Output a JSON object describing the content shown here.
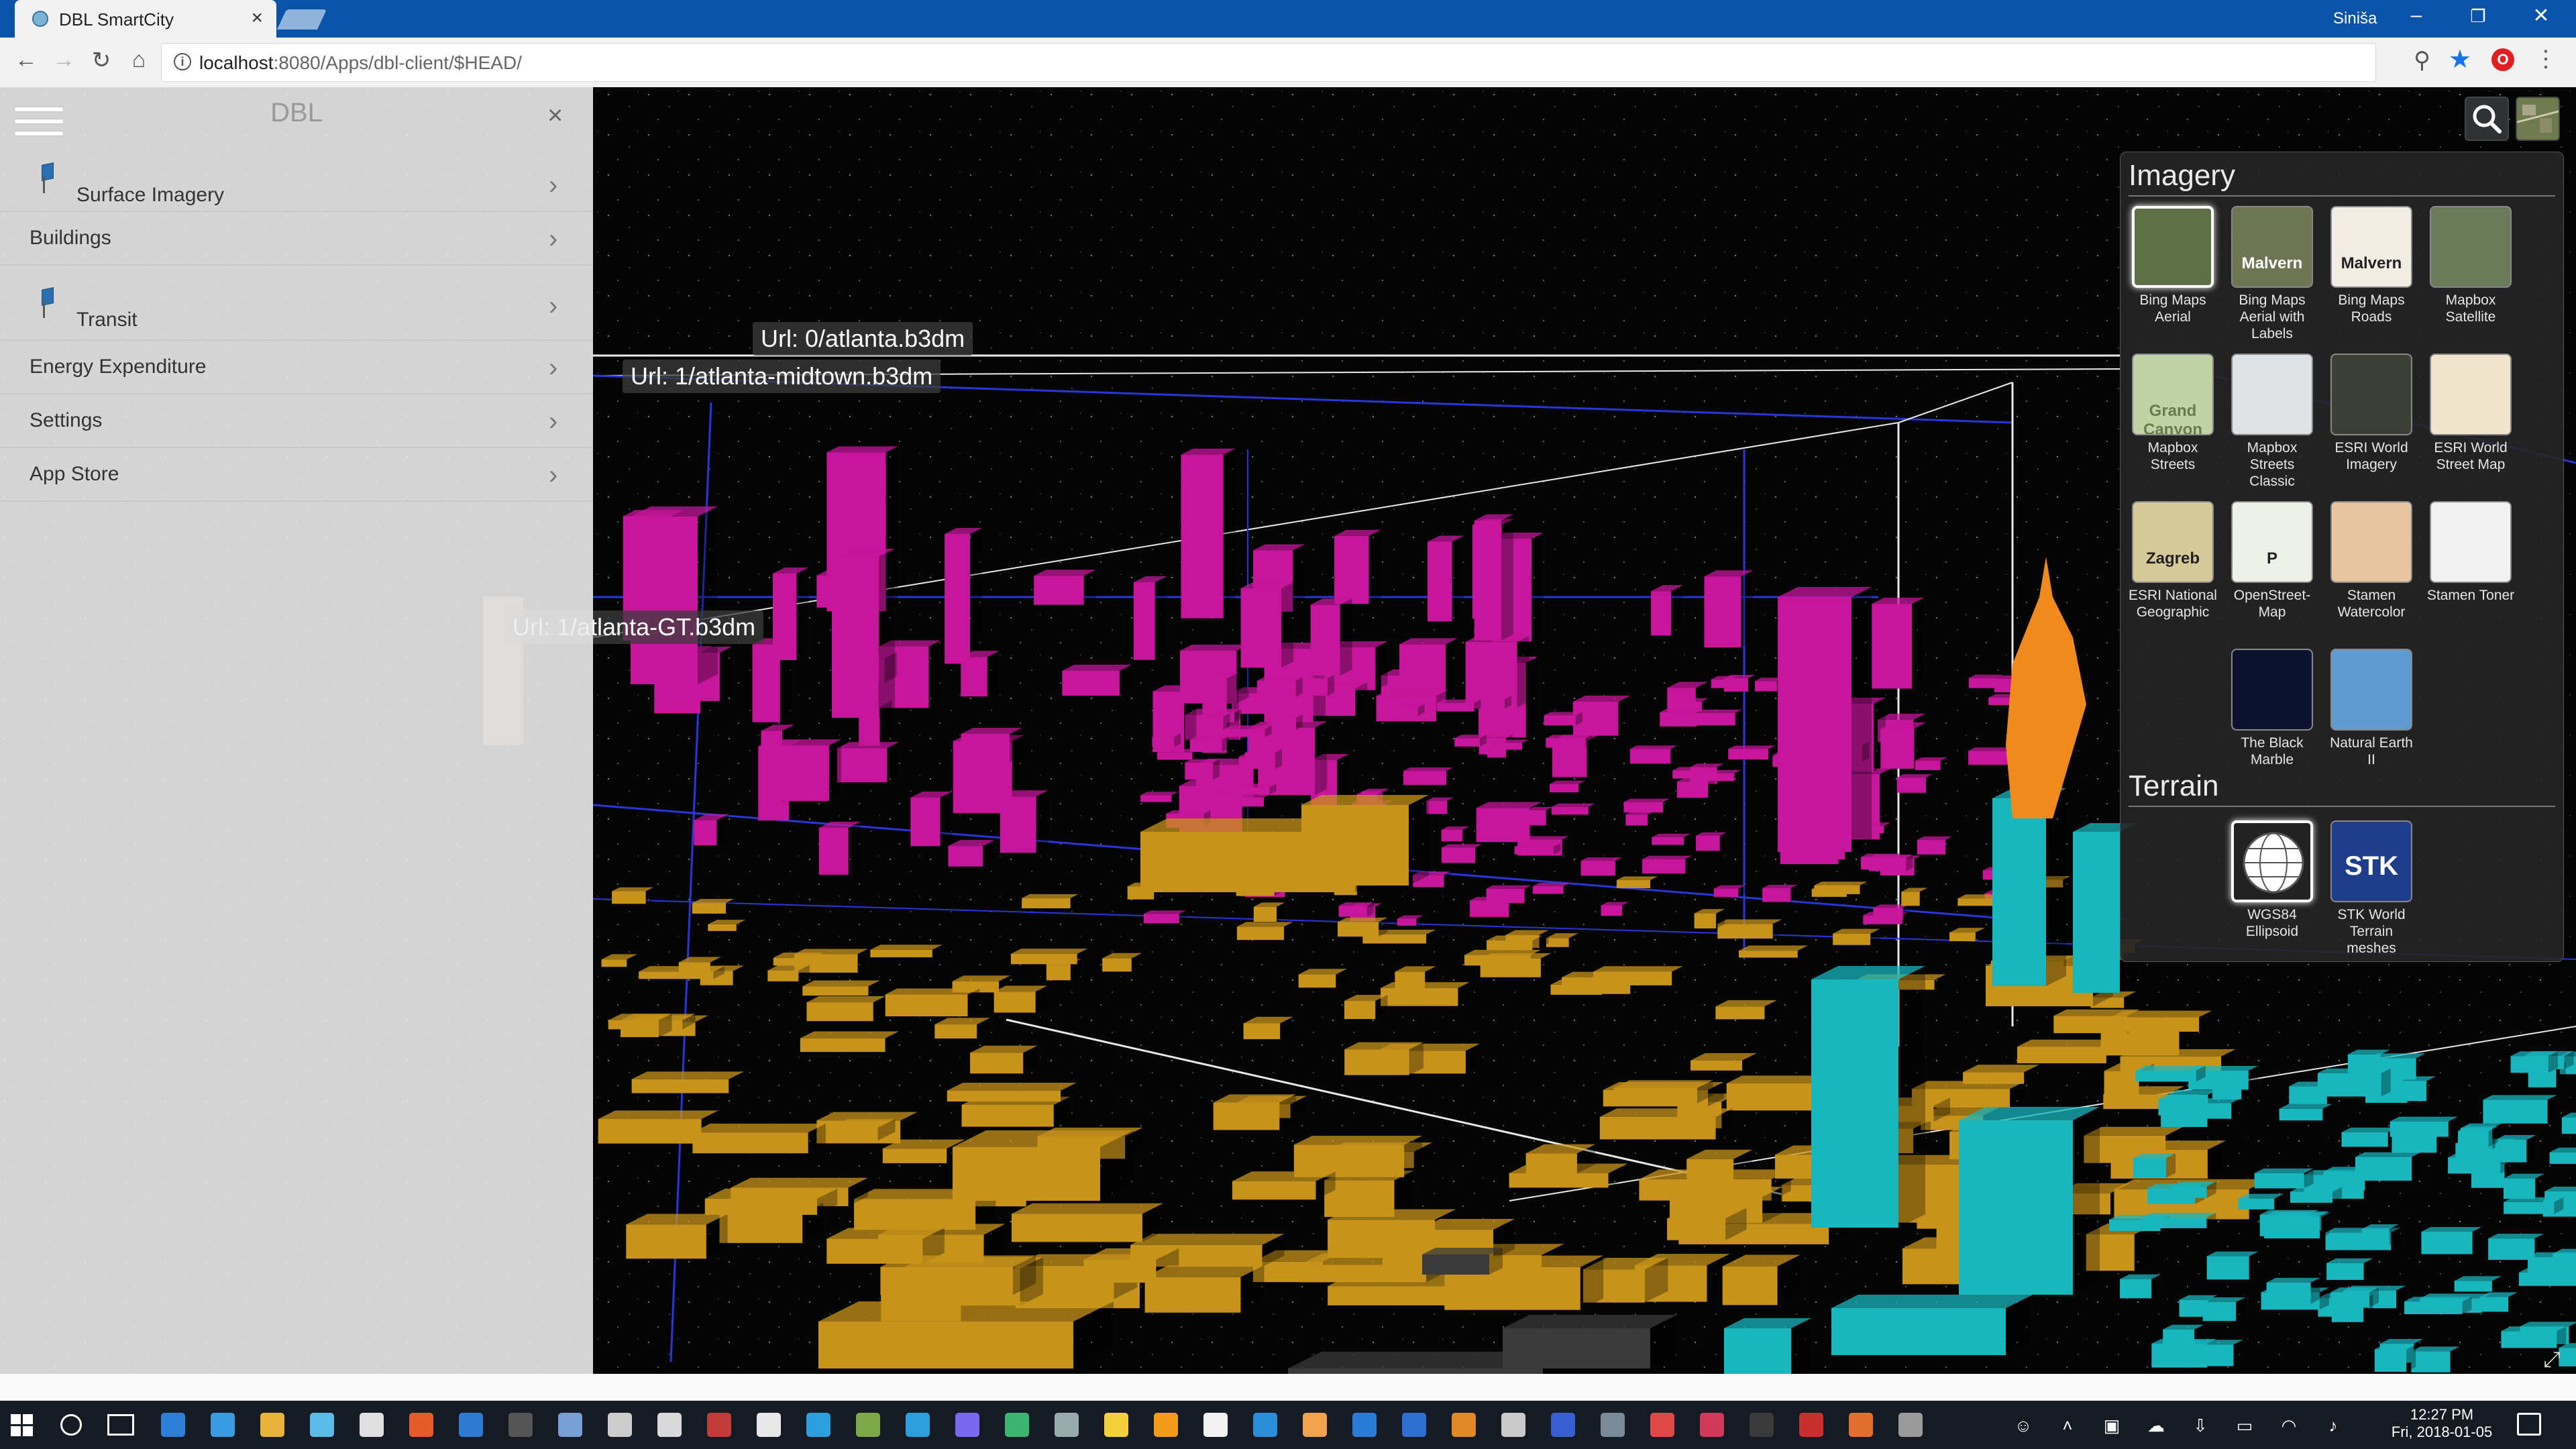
{
  "browser": {
    "tab_title": "DBL SmartCity",
    "user_name": "Siniša",
    "url_host": "localhost",
    "url_path": ":8080/Apps/dbl-client/$HEAD/"
  },
  "panel": {
    "title": "DBL",
    "close_glyph": "×",
    "items": [
      {
        "label": "Surface Imagery",
        "icon": "pin-icon"
      },
      {
        "label": "Buildings"
      },
      {
        "label": "Transit",
        "icon": "pin-icon"
      },
      {
        "label": "Energy Expenditure"
      },
      {
        "label": "Settings"
      },
      {
        "label": "App Store"
      }
    ],
    "chevron_glyph": "›"
  },
  "scene": {
    "labels": [
      "Url: 0/atlanta.b3dm",
      "Url: 1/atlanta-midtown.b3dm",
      "Url: 1/atlanta-GT.b3dm"
    ],
    "colors": {
      "residential": "#c7169b",
      "commercial": "#c8931a",
      "office": "#18b6bd",
      "highlight": "#f08a1e",
      "misc": "#3a3a3a",
      "bbox_blue": "#2a35d8",
      "bbox_white": "#e8e8e8"
    }
  },
  "picker": {
    "imagery_heading": "Imagery",
    "terrain_heading": "Terrain",
    "imagery": [
      {
        "name": "Bing Maps Aerial",
        "selected": true
      },
      {
        "name": "Bing Maps Aerial with Labels",
        "thumb_text": "Malvern"
      },
      {
        "name": "Bing Maps Roads",
        "thumb_text": "Malvern"
      },
      {
        "name": "Mapbox Satellite"
      },
      {
        "name": "Mapbox Streets",
        "thumb_text": "Grand Canyon"
      },
      {
        "name": "Mapbox Streets Classic"
      },
      {
        "name": "ESRI World Imagery"
      },
      {
        "name": "ESRI World Street Map"
      },
      {
        "name": "ESRI National Geographic",
        "thumb_text": "Zagreb"
      },
      {
        "name": "OpenStreet-Map",
        "thumb_text": "P"
      },
      {
        "name": "Stamen Watercolor"
      },
      {
        "name": "Stamen Toner"
      },
      {
        "name": "The Black Marble"
      },
      {
        "name": "Natural Earth II"
      }
    ],
    "terrain": [
      {
        "name": "WGS84 Ellipsoid",
        "selected": true
      },
      {
        "name": "STK World Terrain meshes",
        "thumb_text": "STK"
      }
    ]
  },
  "taskbar": {
    "time": "12:27 PM",
    "date": "Fri, 2018-01-05"
  }
}
